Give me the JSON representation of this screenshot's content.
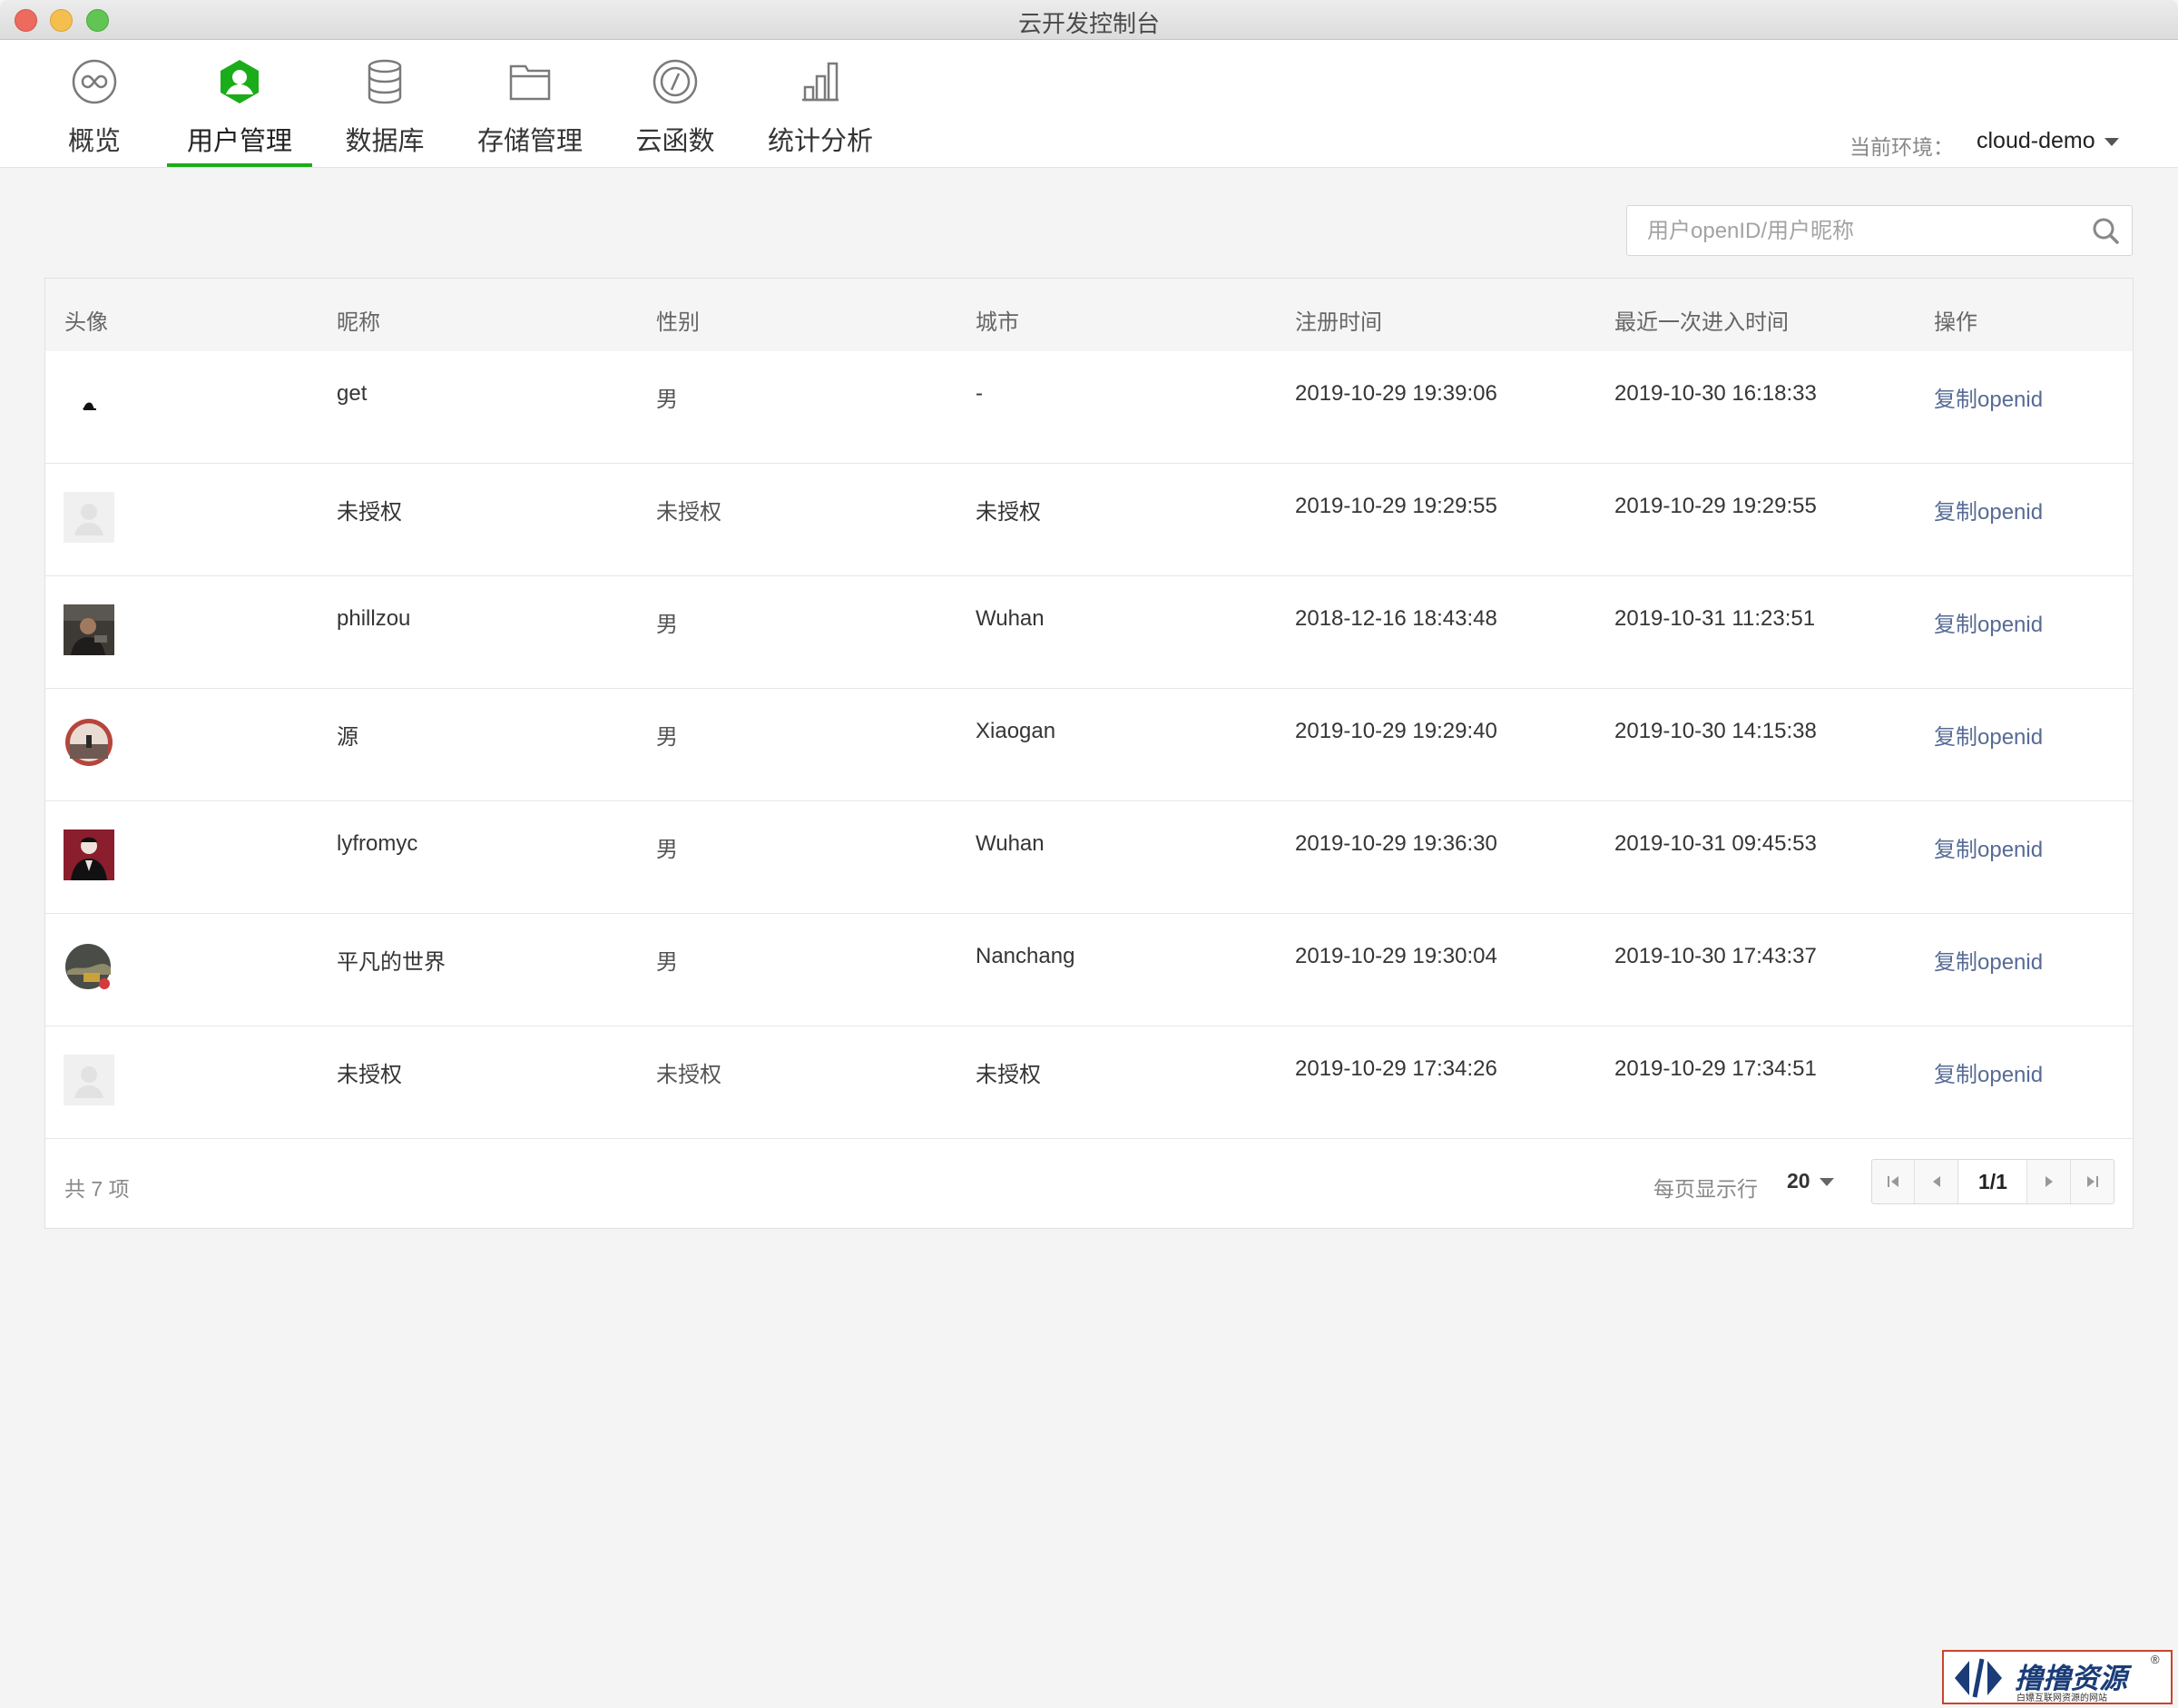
{
  "window": {
    "title": "云开发控制台"
  },
  "nav": {
    "items": [
      {
        "label": "概览",
        "icon": "overview-infinity-icon"
      },
      {
        "label": "用户管理",
        "icon": "user-icon"
      },
      {
        "label": "数据库",
        "icon": "database-icon"
      },
      {
        "label": "存储管理",
        "icon": "folder-icon"
      },
      {
        "label": "云函数",
        "icon": "cloud-function-icon"
      },
      {
        "label": "统计分析",
        "icon": "bar-chart-icon"
      }
    ],
    "active": "用户管理"
  },
  "env": {
    "label": "当前环境：",
    "value": "cloud-demo"
  },
  "search": {
    "placeholder": "用户openID/用户昵称"
  },
  "table": {
    "headers": [
      "头像",
      "昵称",
      "性别",
      "城市",
      "注册时间",
      "最近一次进入时间",
      "操作"
    ],
    "rows": [
      {
        "avatar": "avatar-image",
        "nickname": "get",
        "gender": "男",
        "city": "-",
        "registered": "2019-10-29 19:39:06",
        "last_visit": "2019-10-30 16:18:33",
        "action": "复制openid"
      },
      {
        "avatar": "default-avatar",
        "nickname": "未授权",
        "gender": "未授权",
        "city": "未授权",
        "registered": "2019-10-29 19:29:55",
        "last_visit": "2019-10-29 19:29:55",
        "action": "复制openid"
      },
      {
        "avatar": "avatar-image",
        "nickname": "phillzou",
        "gender": "男",
        "city": "Wuhan",
        "registered": "2018-12-16 18:43:48",
        "last_visit": "2019-10-31 11:23:51",
        "action": "复制openid"
      },
      {
        "avatar": "avatar-image",
        "nickname": "源",
        "gender": "男",
        "city": "Xiaogan",
        "registered": "2019-10-29 19:29:40",
        "last_visit": "2019-10-30 14:15:38",
        "action": "复制openid"
      },
      {
        "avatar": "avatar-image",
        "nickname": "lyfromyc",
        "gender": "男",
        "city": "Wuhan",
        "registered": "2019-10-29 19:36:30",
        "last_visit": "2019-10-31 09:45:53",
        "action": "复制openid"
      },
      {
        "avatar": "avatar-image",
        "nickname": "平凡的世界",
        "gender": "男",
        "city": "Nanchang",
        "registered": "2019-10-29 19:30:04",
        "last_visit": "2019-10-30 17:43:37",
        "action": "复制openid"
      },
      {
        "avatar": "default-avatar",
        "nickname": "未授权",
        "gender": "未授权",
        "city": "未授权",
        "registered": "2019-10-29 17:34:26",
        "last_visit": "2019-10-29 17:34:51",
        "action": "复制openid"
      }
    ]
  },
  "footer": {
    "total": "共 7 项",
    "per_page_label": "每页显示行",
    "per_page_value": "20",
    "page": "1/1"
  },
  "watermark": {
    "text": "撸撸资源",
    "sub": "白嫖互联网资源的网站",
    "reg": "®"
  },
  "colors": {
    "accent": "#1aad19",
    "link": "#576b95",
    "background": "#f4f4f4"
  }
}
